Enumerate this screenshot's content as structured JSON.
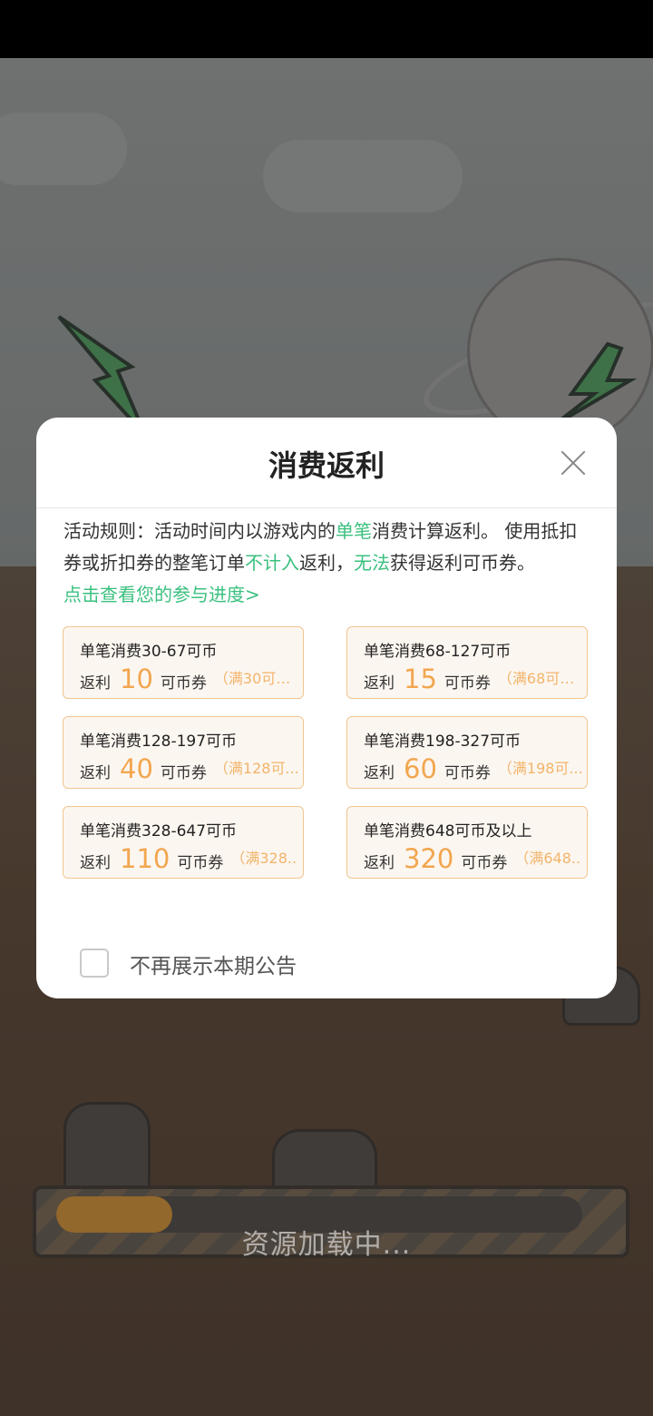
{
  "dialog": {
    "title": "消费返利",
    "rules_prefix": "活动规则：活动时间内以游戏内的",
    "rules_highlight1": "单笔",
    "rules_mid1": "消费计算返利。 使用抵扣券或折扣券的整笔订单",
    "rules_highlight2": "不计入",
    "rules_mid2": "返利，",
    "rules_highlight3": "无法",
    "rules_suffix": "获得返利可币券。",
    "progress_link": "点击查看您的参与进度>",
    "tiers": [
      {
        "range": "单笔消费30-67可币",
        "label": "返利",
        "amount": "10",
        "unit": "可币券",
        "condition": "（满30可用..."
      },
      {
        "range": "单笔消费68-127可币",
        "label": "返利",
        "amount": "15",
        "unit": "可币券",
        "condition": "（满68可用..."
      },
      {
        "range": "单笔消费128-197可币",
        "label": "返利",
        "amount": "40",
        "unit": "可币券",
        "condition": "（满128可..."
      },
      {
        "range": "单笔消费198-327可币",
        "label": "返利",
        "amount": "60",
        "unit": "可币券",
        "condition": "（满198可..."
      },
      {
        "range": "单笔消费328-647可币",
        "label": "返利",
        "amount": "110",
        "unit": "可币券",
        "condition": "（满328..."
      },
      {
        "range": "单笔消费648可币及以上",
        "label": "返利",
        "amount": "320",
        "unit": "可币券",
        "condition": "（满648..."
      }
    ],
    "dont_show_label": "不再展示本期公告"
  },
  "background": {
    "loading_text": "资源加载中...",
    "progress_fraction": 0.22
  },
  "colors": {
    "accent_green": "#3bc07f",
    "amount_orange": "#f2a64f",
    "tier_border": "#f2c592"
  },
  "icons": {
    "close": "close-icon"
  }
}
